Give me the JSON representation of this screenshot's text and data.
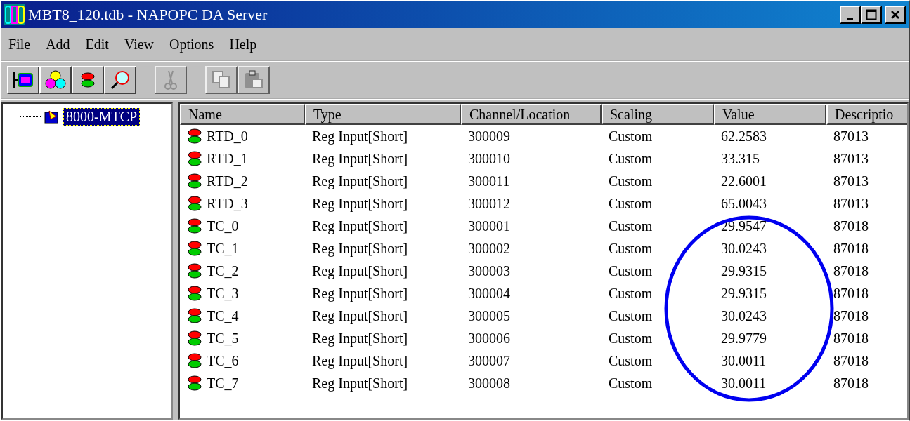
{
  "window": {
    "title": "MBT8_120.tdb - NAPOPC DA Server"
  },
  "menu": [
    "File",
    "Add",
    "Edit",
    "View",
    "Options",
    "Help"
  ],
  "toolbar": [
    {
      "kind": "device",
      "disabled": false
    },
    {
      "kind": "colors",
      "disabled": false
    },
    {
      "kind": "tag",
      "disabled": false
    },
    {
      "kind": "search",
      "disabled": false
    },
    {
      "kind": "cut",
      "disabled": true
    },
    {
      "kind": "copy",
      "disabled": true
    },
    {
      "kind": "paste",
      "disabled": true
    }
  ],
  "tree": [
    {
      "label": "8000-MTCP",
      "selected": true
    }
  ],
  "table": {
    "columns": [
      "Name",
      "Type",
      "Channel/Location",
      "Scaling",
      "Value",
      "Descriptio"
    ],
    "rows": [
      [
        "RTD_0",
        "Reg Input[Short]",
        "300009",
        "Custom",
        "62.2583",
        "87013"
      ],
      [
        "RTD_1",
        "Reg Input[Short]",
        "300010",
        "Custom",
        "33.315",
        "87013"
      ],
      [
        "RTD_2",
        "Reg Input[Short]",
        "300011",
        "Custom",
        "22.6001",
        "87013"
      ],
      [
        "RTD_3",
        "Reg Input[Short]",
        "300012",
        "Custom",
        "65.0043",
        "87013"
      ],
      [
        "TC_0",
        "Reg Input[Short]",
        "300001",
        "Custom",
        "29.9547",
        "87018"
      ],
      [
        "TC_1",
        "Reg Input[Short]",
        "300002",
        "Custom",
        "30.0243",
        "87018"
      ],
      [
        "TC_2",
        "Reg Input[Short]",
        "300003",
        "Custom",
        "29.9315",
        "87018"
      ],
      [
        "TC_3",
        "Reg Input[Short]",
        "300004",
        "Custom",
        "29.9315",
        "87018"
      ],
      [
        "TC_4",
        "Reg Input[Short]",
        "300005",
        "Custom",
        "30.0243",
        "87018"
      ],
      [
        "TC_5",
        "Reg Input[Short]",
        "300006",
        "Custom",
        "29.9779",
        "87018"
      ],
      [
        "TC_6",
        "Reg Input[Short]",
        "300007",
        "Custom",
        "30.0011",
        "87018"
      ],
      [
        "TC_7",
        "Reg Input[Short]",
        "300008",
        "Custom",
        "30.0011",
        "87018"
      ]
    ]
  }
}
